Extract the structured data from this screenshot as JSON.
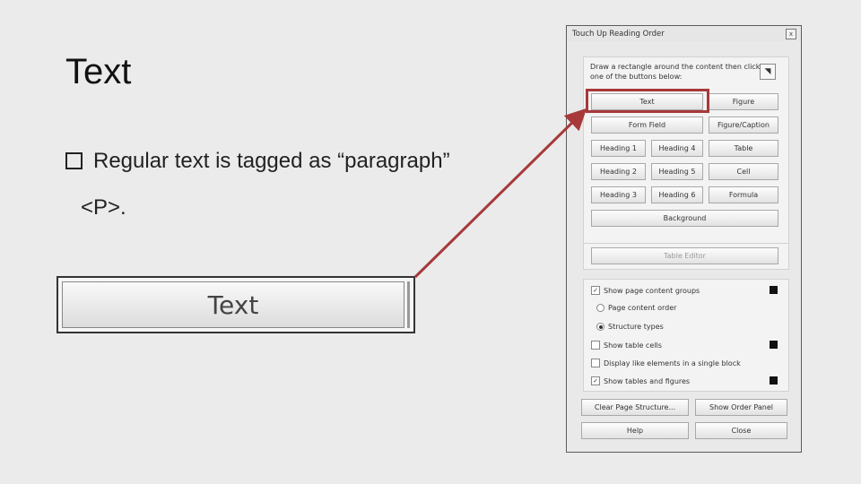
{
  "slide": {
    "title": "Text",
    "bullet": "Regular text is tagged as “paragraph”",
    "bullet_cont": "<P>."
  },
  "zoom": {
    "label": "Text"
  },
  "dialog": {
    "title": "Touch Up Reading Order",
    "close": "x",
    "instructions": "Draw a rectangle around the content then click one of the buttons below:",
    "tag_buttons": [
      "Text",
      "Figure",
      "Form Field",
      "Figure/Caption",
      "Heading 1",
      "Heading 4",
      "Table",
      "Heading 2",
      "Heading 5",
      "Cell",
      "Heading 3",
      "Heading 6",
      "Formula",
      "Background"
    ],
    "table_editor": "Table Editor",
    "options": {
      "show_groups": "Show page content groups",
      "page_order": "Page content order",
      "structure_types": "Structure types",
      "show_cells": "Show table cells",
      "display_like": "Display like elements in a single block",
      "show_tables": "Show tables and figures"
    },
    "bottom": {
      "clear": "Clear Page Structure...",
      "show_order": "Show Order Panel",
      "help": "Help",
      "close": "Close"
    }
  },
  "colors": {
    "highlight": "#a7393a",
    "arrow": "#a7393a"
  }
}
